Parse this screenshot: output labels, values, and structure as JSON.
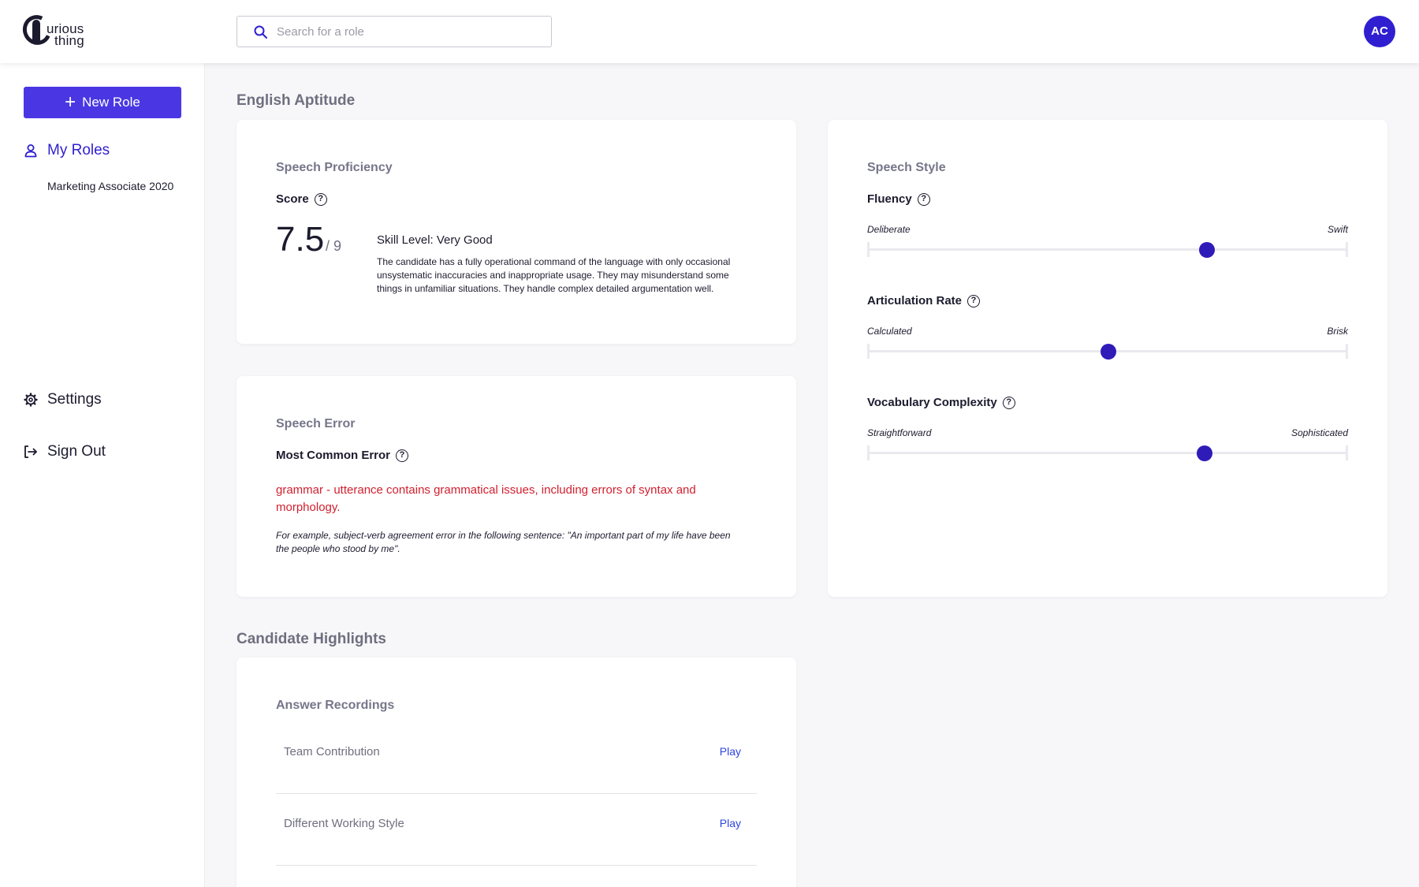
{
  "header": {
    "logo_line1": "urious",
    "logo_line2": "thing",
    "search_placeholder": "Search for a role",
    "avatar_initials": "AC",
    "accent_color": "#2f1fd1"
  },
  "sidebar": {
    "new_role_label": "New Role",
    "my_roles_label": "My Roles",
    "role_item": "Marketing Associate 2020",
    "settings_label": "Settings",
    "sign_out_label": "Sign Out"
  },
  "english_aptitude": {
    "section_title": "English Aptitude",
    "speech_proficiency": {
      "title": "Speech Proficiency",
      "score_label": "Score",
      "score_value": "7.5",
      "score_max": "/ 9",
      "skill_level": "Skill Level: Very Good",
      "description": "The candidate has a fully operational command of the language with only occasional unsystematic inaccuracies and inappropriate usage. They may misunderstand some things in unfamiliar situations. They handle complex detailed argumentation well."
    },
    "speech_error": {
      "title": "Speech Error",
      "label": "Most Common Error",
      "error_text": "grammar - utterance contains grammatical issues, including errors of syntax and morphology.",
      "example": "For example, subject-verb agreement error in the following sentence: \"An important part of my life have been the people who stood by me\"."
    },
    "speech_style": {
      "title": "Speech Style",
      "sliders": [
        {
          "label": "Fluency",
          "min_label": "Deliberate",
          "max_label": "Swift",
          "value": 0.707
        },
        {
          "label": "Articulation Rate",
          "min_label": "Calculated",
          "max_label": "Brisk",
          "value": 0.502
        },
        {
          "label": "Vocabulary Complexity",
          "min_label": "Straightforward",
          "max_label": "Sophisticated",
          "value": 0.702
        }
      ]
    }
  },
  "candidate_highlights": {
    "section_title": "Candidate Highlights",
    "card_title": "Answer Recordings",
    "recordings": [
      {
        "name": "Team Contribution",
        "action": "Play"
      },
      {
        "name": "Different Working Style",
        "action": "Play"
      }
    ]
  }
}
